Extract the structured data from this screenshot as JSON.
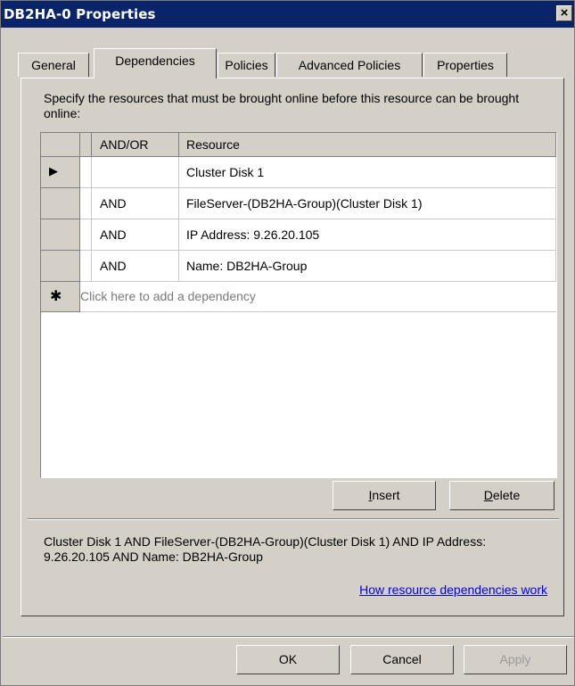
{
  "window": {
    "title": "DB2HA-0 Properties",
    "close_glyph": "×"
  },
  "tabs": [
    {
      "label": "General"
    },
    {
      "label": "Dependencies"
    },
    {
      "label": "Policies"
    },
    {
      "label": "Advanced Policies"
    },
    {
      "label": "Properties"
    }
  ],
  "selected_tab": "Dependencies",
  "description": "Specify the resources that must be brought online before this resource can be brought online:",
  "grid": {
    "headers": {
      "andor": "AND/OR",
      "resource": "Resource"
    },
    "rows": [
      {
        "andor": "",
        "resource": "Cluster Disk 1",
        "current": true
      },
      {
        "andor": "AND",
        "resource": "FileServer-(DB2HA-Group)(Cluster Disk 1)"
      },
      {
        "andor": "AND",
        "resource": "IP Address: 9.26.20.105"
      },
      {
        "andor": "AND",
        "resource": "Name: DB2HA-Group"
      }
    ],
    "new_row_glyph": "✱",
    "current_row_glyph": "▶",
    "new_row_prompt": "Click here to add a dependency"
  },
  "buttons": {
    "insert": {
      "label": "Insert",
      "accel": "I",
      "rest": "nsert"
    },
    "delete": {
      "label": "Delete",
      "accel": "D",
      "rest": "elete"
    },
    "ok": "OK",
    "cancel": "Cancel",
    "apply": "Apply"
  },
  "summary": "Cluster Disk 1 AND FileServer-(DB2HA-Group)(Cluster Disk 1) AND IP Address: 9.26.20.105 AND Name: DB2HA-Group",
  "help_link": "How resource dependencies work "
}
